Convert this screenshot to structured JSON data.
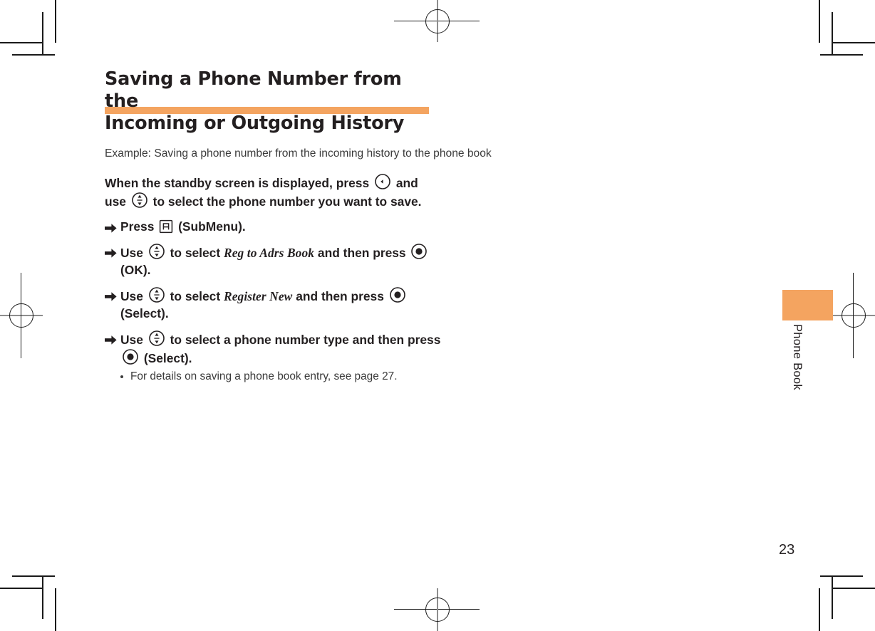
{
  "page": {
    "title_line1": "Saving a Phone Number from the",
    "title_line2": "Incoming or Outgoing History",
    "accent_color": "#F4A460",
    "page_number": "23",
    "side_tab_label": "Phone Book"
  },
  "example": {
    "label": "Example:",
    "line1": "Saving a phone number from the incoming history",
    "line2": "to the phone book"
  },
  "lede": {
    "part1": "When the standby screen is displayed, press",
    "key1": "left-arrow-key",
    "part2": "and use",
    "key2": "up-down-navigation-key",
    "part3": "to select the phone number you want to save."
  },
  "steps": [
    {
      "arrow": "step-arrow-icon",
      "part1": "Press",
      "key1": "submenu-a-key",
      "part2": "(SubMenu)."
    },
    {
      "arrow": "step-arrow-icon",
      "part1": "Use",
      "key1": "up-down-navigation-key",
      "part2": "to select",
      "term": "Reg to Adrs Book",
      "part3": "and then press",
      "key2": "center-ok-key",
      "part4": "(OK)."
    },
    {
      "arrow": "step-arrow-icon",
      "part1": "Use",
      "key1": "up-down-navigation-key",
      "part2": "to select",
      "term": "Register New",
      "part3": "and then press",
      "key2": "center-ok-key",
      "part4": "(Select)."
    },
    {
      "arrow": "step-arrow-icon",
      "part1": "Use",
      "key1": "up-down-navigation-key",
      "part2": "to select a phone number type and then press",
      "key2": "center-ok-key",
      "part4": "(Select).",
      "note": "For details on saving a phone book entry, see page 27."
    }
  ]
}
